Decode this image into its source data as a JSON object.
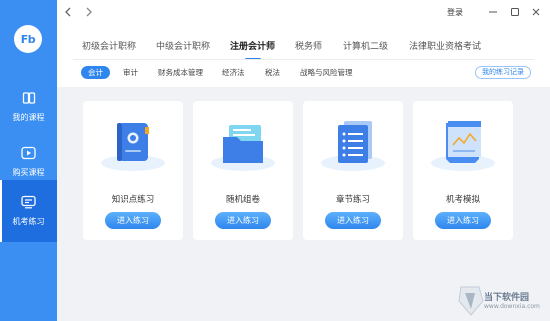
{
  "app": {
    "logo_text": "Fb",
    "login_label": "登录",
    "accent_color": "#2f86ee",
    "sidebar_color": "#3b8ff2"
  },
  "sidebar": {
    "items": [
      {
        "label": "我的课程",
        "icon": "book-icon",
        "active": false
      },
      {
        "label": "购买课程",
        "icon": "play-icon",
        "active": false
      },
      {
        "label": "机考练习",
        "icon": "exam-icon",
        "active": true
      }
    ]
  },
  "tabs": [
    {
      "label": "初级会计职称",
      "active": false
    },
    {
      "label": "中级会计职称",
      "active": false
    },
    {
      "label": "注册会计师",
      "active": true
    },
    {
      "label": "税务师",
      "active": false
    },
    {
      "label": "计算机二级",
      "active": false
    },
    {
      "label": "法律职业资格考试",
      "active": false
    }
  ],
  "subtabs": [
    {
      "label": "会计",
      "active": true
    },
    {
      "label": "审计",
      "active": false
    },
    {
      "label": "财务成本管理",
      "active": false
    },
    {
      "label": "经济法",
      "active": false
    },
    {
      "label": "税法",
      "active": false
    },
    {
      "label": "战略与风险管理",
      "active": false
    }
  ],
  "practice_record_label": "我的练习记录",
  "cards": [
    {
      "title": "知识点练习",
      "button": "进入练习",
      "icon": "notebook-icon"
    },
    {
      "title": "随机组卷",
      "button": "进入练习",
      "icon": "folder-icon"
    },
    {
      "title": "章节练习",
      "button": "进入练习",
      "icon": "document-stack-icon"
    },
    {
      "title": "机考模拟",
      "button": "进入练习",
      "icon": "chart-paper-icon"
    }
  ],
  "watermark": {
    "text": "当下软件园",
    "sub": "www.downxia.com"
  }
}
